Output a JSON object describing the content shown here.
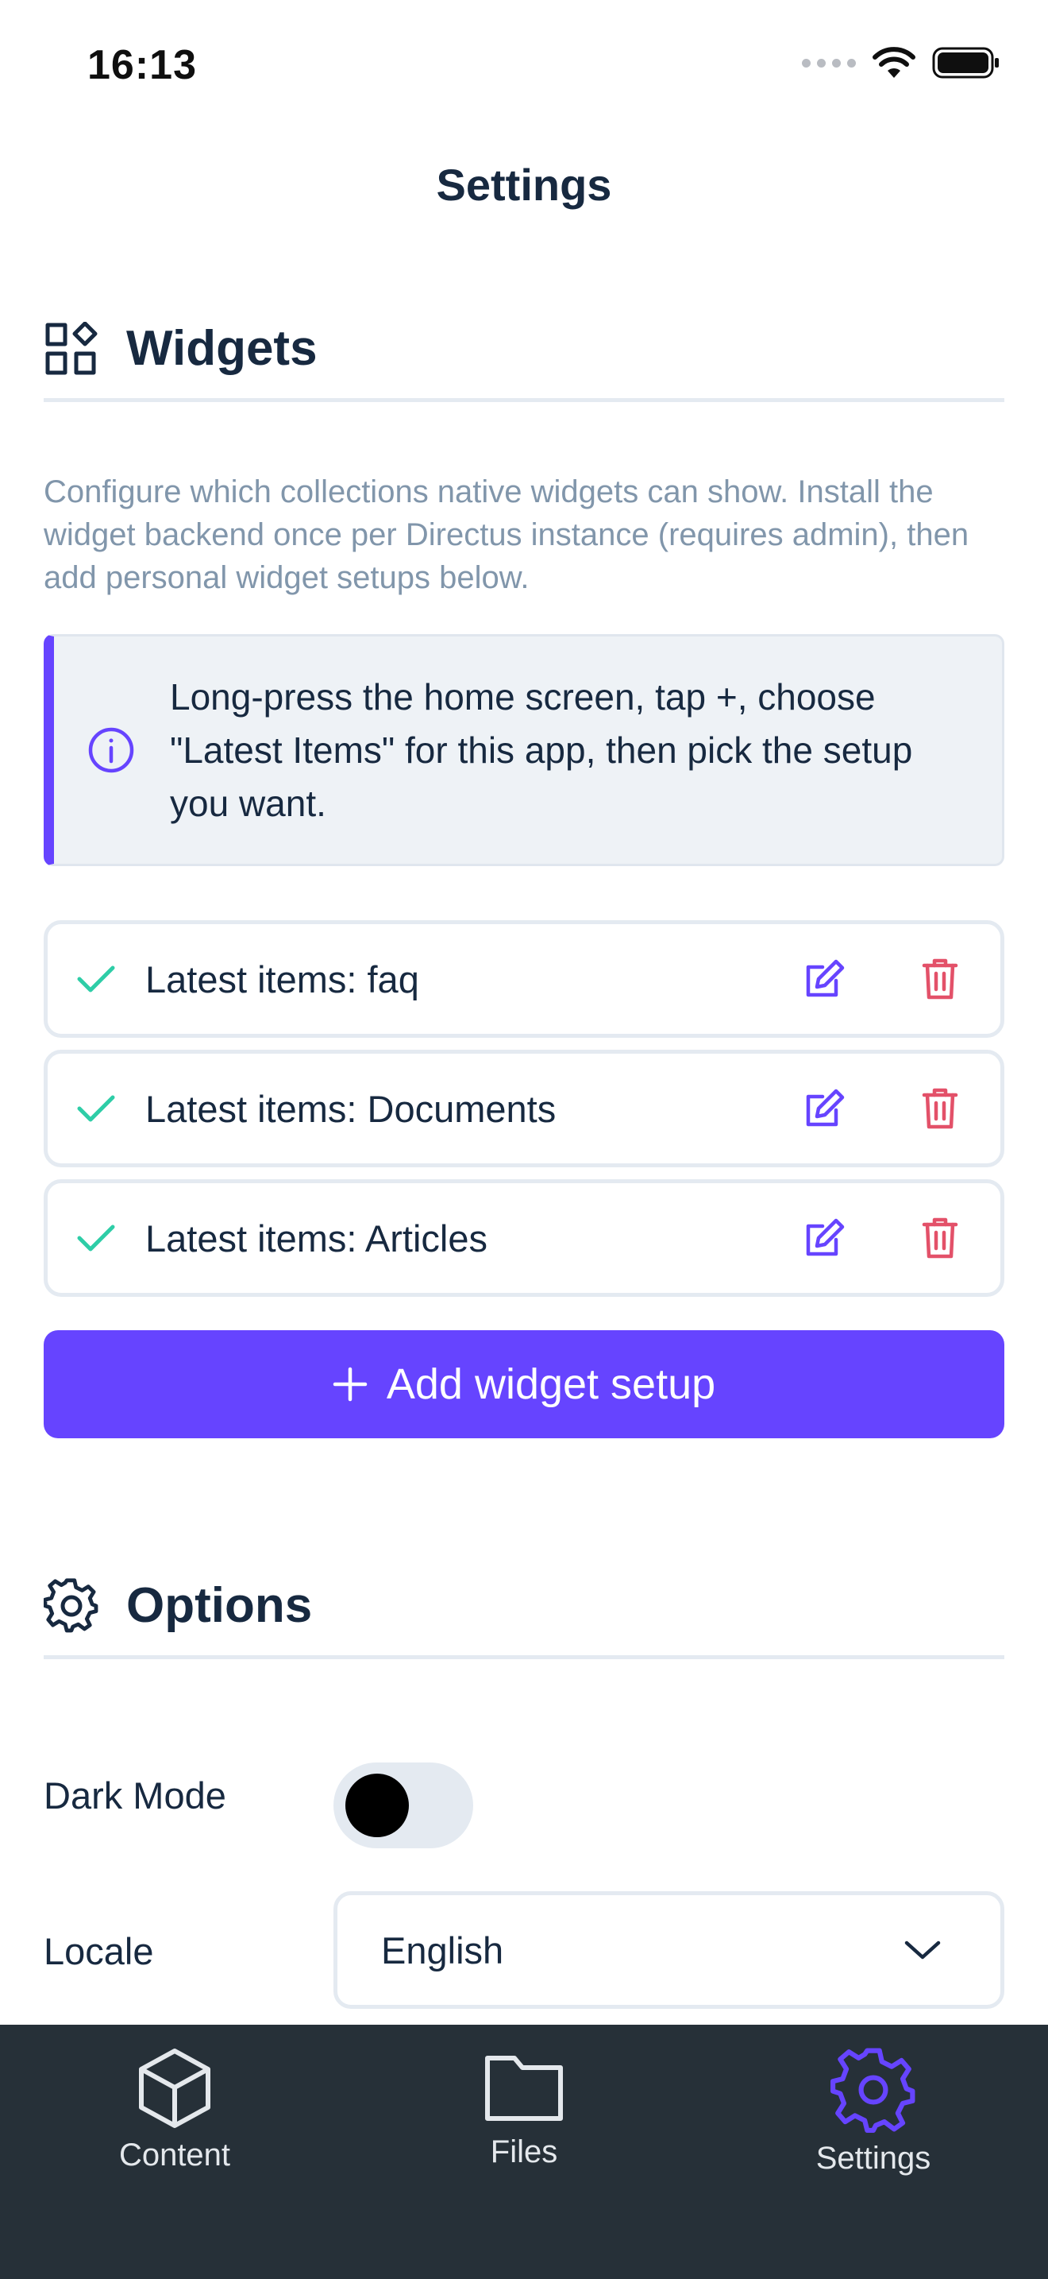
{
  "status_bar": {
    "time": "16:13"
  },
  "header": {
    "title": "Settings"
  },
  "widgets_section": {
    "title": "Widgets",
    "description": "Configure which collections native widgets can show. Install the widget backend once per Directus instance (requires admin), then add personal widget setups below.",
    "notice": "Long-press the home screen, tap +, choose \"Latest Items\" for this app, then pick the setup you want.",
    "items": [
      {
        "label": "Latest items: faq"
      },
      {
        "label": "Latest items: Documents"
      },
      {
        "label": "Latest items: Articles"
      }
    ],
    "add_button_label": "Add widget setup"
  },
  "options_section": {
    "title": "Options",
    "dark_mode_label": "Dark Mode",
    "dark_mode_enabled": false,
    "locale_label": "Locale",
    "locale_value": "English"
  },
  "bottom_nav": {
    "items": [
      {
        "label": "Content",
        "icon": "cube-icon",
        "active": false
      },
      {
        "label": "Files",
        "icon": "folder-icon",
        "active": false
      },
      {
        "label": "Settings",
        "icon": "gear-icon",
        "active": true
      }
    ]
  },
  "colors": {
    "accent": "#6644ff",
    "success": "#2ecda7",
    "danger": "#e35169",
    "nav_background": "#263038",
    "text": "#172940",
    "muted_text": "#8196ab"
  }
}
